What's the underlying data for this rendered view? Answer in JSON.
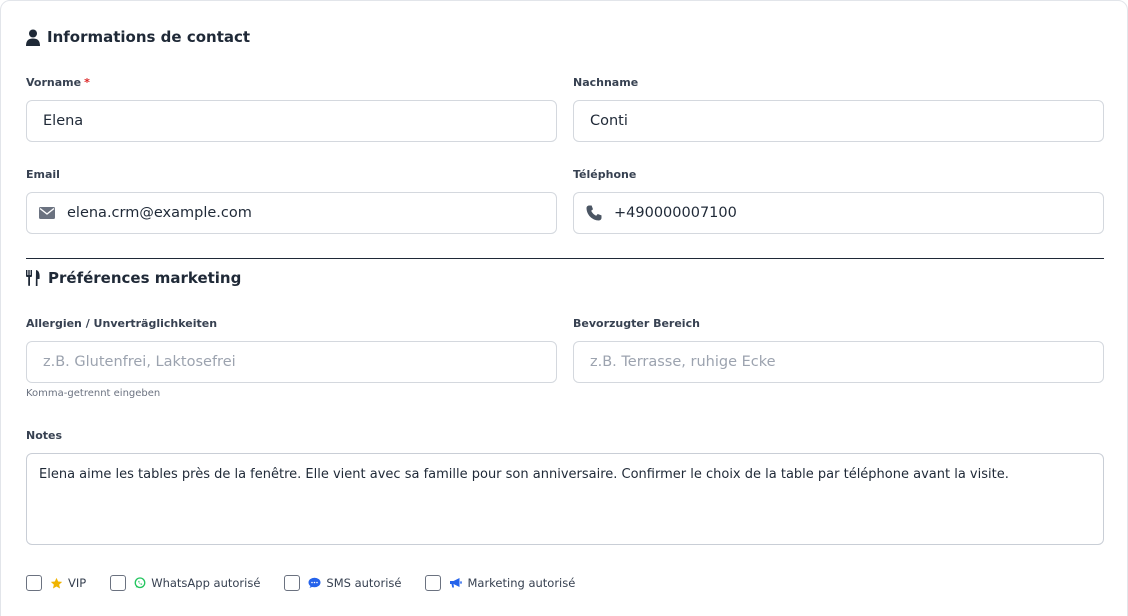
{
  "contact": {
    "title": "Informations de contact",
    "first_name": {
      "label": "Vorname",
      "required_mark": "*",
      "value": "Elena"
    },
    "last_name": {
      "label": "Nachname",
      "value": "Conti"
    },
    "email": {
      "label": "Email",
      "value": "elena.crm@example.com",
      "icon": "envelope-icon"
    },
    "phone": {
      "label": "Téléphone",
      "value": "+490000007100",
      "icon": "phone-icon"
    }
  },
  "marketing": {
    "title": "Préférences marketing",
    "allergies": {
      "label": "Allergien / Unverträglichkeiten",
      "placeholder": "z.B. Glutenfrei, Laktosefrei",
      "helper": "Komma-getrennt eingeben"
    },
    "area": {
      "label": "Bevorzugter Bereich",
      "placeholder": "z.B. Terrasse, ruhige Ecke"
    },
    "notes": {
      "label": "Notes",
      "value": "Elena aime les tables près de la fenêtre. Elle vient avec sa famille pour son anniversaire. Confirmer le choix de la table par téléphone avant la visite."
    },
    "checkboxes": [
      {
        "label": "VIP",
        "icon": "star-icon",
        "icon_color": "#f0b400",
        "checked": false
      },
      {
        "label": "WhatsApp autorisé",
        "icon": "whatsapp-icon",
        "icon_color": "#22c55e",
        "checked": false
      },
      {
        "label": "SMS autorisé",
        "icon": "sms-icon",
        "icon_color": "#2563eb",
        "checked": false
      },
      {
        "label": "Marketing autorisé",
        "icon": "megaphone-icon",
        "icon_color": "#2563eb",
        "checked": false
      }
    ]
  },
  "colors": {
    "required": "#dc2626",
    "text": "#1f2937",
    "placeholder": "#9ca3af",
    "border": "#d4d8de"
  }
}
